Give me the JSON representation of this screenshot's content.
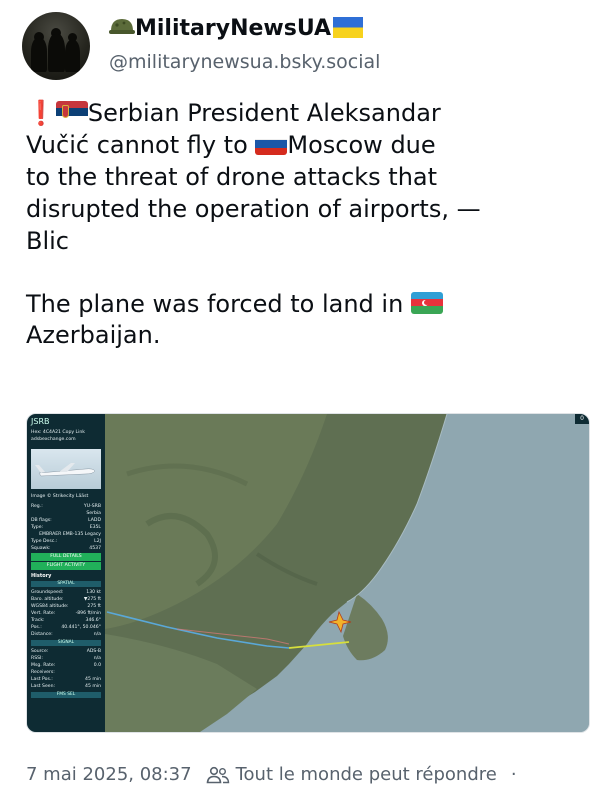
{
  "author": {
    "display_name": "MilitaryNewsUA",
    "handle": "@militarynewsua.bsky.social",
    "name_prefix_icon": "helmet-icon",
    "name_suffix_icon": "ukraine-flag-icon"
  },
  "post": {
    "exclamation": "❗",
    "line1_part1": "Serbian President Aleksandar",
    "line2_part1": "Vučić cannot fly to ",
    "line2_part2": "Moscow due",
    "line3": "to the threat of drone attacks that",
    "line4": "disrupted the operation of airports, —",
    "line5": "Blic",
    "para2_part1": "The plane was forced to land in ",
    "para2_part2": "Azerbaijan."
  },
  "media": {
    "panel_title": "JSRB",
    "corner": "0",
    "hex_line": "Hex: 4C4A21   Copy Link",
    "site": "adsbexchange.com",
    "photo_credit": "Image © Strikecity Lääst",
    "details": [
      {
        "label": "Reg.:",
        "value": "YU-SRB"
      },
      {
        "label": "",
        "value": "Serbia"
      },
      {
        "label": "DB flags:",
        "value": "LADD"
      },
      {
        "label": "Type:",
        "value": "E35L"
      },
      {
        "label": "",
        "value": "EMBRAER EMB-135 Legacy"
      },
      {
        "label": "Type Desc.:",
        "value": "L2J"
      },
      {
        "label": "Squawk:",
        "value": "4537"
      }
    ],
    "btn_full_details": "FULL DETAILS",
    "btn_flight_activity": "FLIGHT ACTIVITY",
    "history": "History",
    "spatial": "SPATIAL",
    "spatial_rows": [
      {
        "label": "Groundspeed:",
        "value": "130 kt"
      },
      {
        "label": "Baro. altitude:",
        "value": "▼275 ft"
      },
      {
        "label": "WGS84 altitude:",
        "value": "275 ft"
      },
      {
        "label": "Vert. Rate:",
        "value": "-896 ft/min"
      },
      {
        "label": "Track:",
        "value": "346.6°"
      },
      {
        "label": "Pos.:",
        "value": "40.441°, 50.046°"
      },
      {
        "label": "Distance:",
        "value": "n/a"
      }
    ],
    "signal": "SIGNAL",
    "signal_rows": [
      {
        "label": "Source:",
        "value": "ADS-B"
      },
      {
        "label": "RSSI:",
        "value": "n/a"
      },
      {
        "label": "Msg. Rate:",
        "value": "0.0"
      },
      {
        "label": "Receivers:",
        "value": ""
      },
      {
        "label": "Last Pos.:",
        "value": "45 min"
      },
      {
        "label": "Last Seen:",
        "value": "45 min"
      }
    ],
    "fms": "FMS SEL"
  },
  "footer": {
    "date": "7 mai 2025, 08:37",
    "reply_setting": "Tout le monde peut répondre",
    "separator": "·",
    "people_icon": "people-icon"
  },
  "colors": {
    "handle": "#58626d",
    "map_sea": "#8fa7b0",
    "map_land": "#5f6f52",
    "panel_bg": "#0e2b33",
    "button_green": "#21b05a",
    "track_yellow": "#d7df3c"
  }
}
